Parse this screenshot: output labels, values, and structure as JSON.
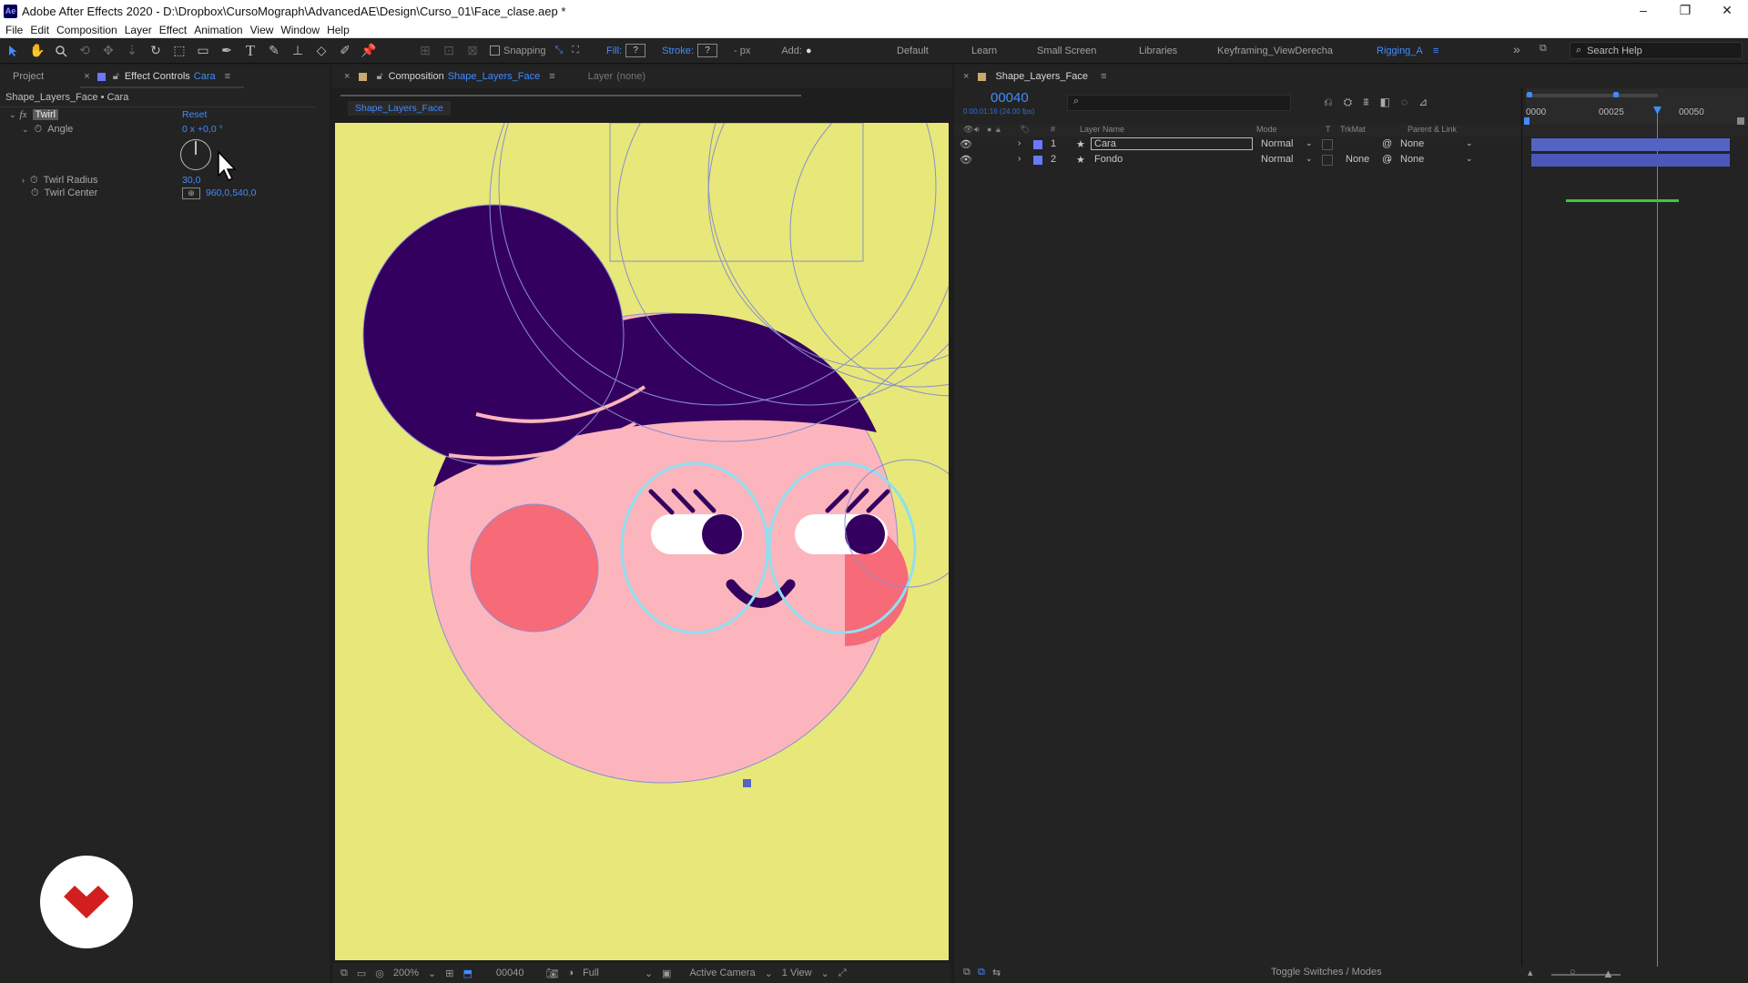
{
  "window": {
    "title": "Adobe After Effects 2020 - D:\\Dropbox\\CursoMograph\\AdvancedAE\\Design\\Curso_01\\Face_clase.aep *",
    "logo_text": "Ae",
    "controls": [
      "–",
      "❐",
      "✕"
    ]
  },
  "menu": [
    "File",
    "Edit",
    "Composition",
    "Layer",
    "Effect",
    "Animation",
    "View",
    "Window",
    "Help"
  ],
  "toolbar": {
    "snapping_label": "Snapping",
    "fill_label": "Fill:",
    "fill_value": "?",
    "stroke_label": "Stroke:",
    "stroke_value": "?",
    "px_label": "- px",
    "add_label": "Add:",
    "add_icon": "●"
  },
  "workspaces": [
    "Default",
    "Learn",
    "Small Screen",
    "Libraries",
    "Keyframing_ViewDerecha",
    "Rigging_A"
  ],
  "workspace_active": "Rigging_A",
  "search_placeholder": "Search Help",
  "left_panel": {
    "project_tab": "Project",
    "effect_tab": "Effect Controls",
    "effect_tab_layer": "Cara",
    "breadcrumb": "Shape_Layers_Face • Cara",
    "effect_fx": "fx",
    "effect_name": "Twirl",
    "reset_label": "Reset",
    "props": [
      {
        "name": "Angle",
        "value": "0 x +0,0 °"
      },
      {
        "name": "Twirl Radius",
        "value": "30,0"
      },
      {
        "name": "Twirl Center",
        "value": "960,0,540,0"
      }
    ]
  },
  "composition": {
    "tab_prefix": "Composition",
    "tab_name": "Shape_Layers_Face",
    "layer_label": "Layer",
    "layer_value": "(none)",
    "sub_tab": "Shape_Layers_Face",
    "zoom": "200%",
    "timecode": "00040",
    "resolution": "Full",
    "camera": "Active Camera",
    "views": "1 View"
  },
  "timeline": {
    "tab": "Shape_Layers_Face",
    "timecode": "00040",
    "timecode_sub": "0:00:01:16 (24.00 fps)",
    "search_icon": "search-icon",
    "headers": [
      "#",
      "Layer Name",
      "Mode",
      "T",
      "TrkMat",
      "Parent & Link"
    ],
    "ruler": [
      "0000",
      "00025",
      "00050"
    ],
    "layers": [
      {
        "num": "1",
        "name": "Cara",
        "mode": "Normal",
        "trkmat": "",
        "parent": "None"
      },
      {
        "num": "2",
        "name": "Fondo",
        "mode": "Normal",
        "trkmat": "None",
        "parent": "None"
      }
    ],
    "footer": "Toggle Switches / Modes"
  },
  "colors": {
    "accent": "#3f8cff",
    "background_yellow": "#e7e879",
    "hair": "#34005f",
    "face": "#fdb5bd",
    "cheek": "#f76a78",
    "glasses": "#8ee0f0",
    "label_purple": "#6b78ff",
    "layer_bar": "#5563c4"
  }
}
